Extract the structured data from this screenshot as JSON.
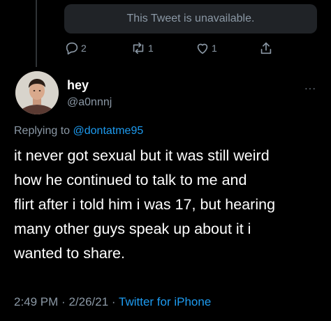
{
  "unavailable": {
    "text": "This Tweet is unavailable."
  },
  "actions": {
    "reply": {
      "icon": "reply-icon",
      "count": "2"
    },
    "retweet": {
      "icon": "retweet-icon",
      "count": "1"
    },
    "like": {
      "icon": "like-icon",
      "count": "1"
    },
    "share": {
      "icon": "share-icon"
    }
  },
  "tweet": {
    "display_name": "hey",
    "handle": "@a0nnnj",
    "more_label": "···",
    "replying_prefix": "Replying to ",
    "replying_to": "@dontatme95",
    "lines": [
      "it never got sexual but it was still weird",
      "how he continued to talk to me and",
      "flirt after i told him i was 17, but hearing",
      "many other guys speak up about it i",
      "wanted to share."
    ],
    "time": "2:49 PM",
    "separator": "·",
    "date": "2/26/21",
    "source": "Twitter for iPhone"
  },
  "colors": {
    "background": "#000000",
    "text": "#ffffff",
    "secondary": "#8b98a5",
    "accent": "#1d9bf0",
    "card": "#202327"
  }
}
